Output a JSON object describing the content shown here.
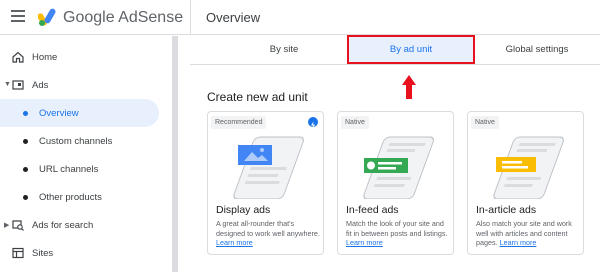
{
  "header": {
    "brand": "Google AdSense",
    "page_title": "Overview",
    "logo_colors": [
      "#fbbc04",
      "#4285f4",
      "#34a853"
    ]
  },
  "sidebar": {
    "items": [
      {
        "label": "Home",
        "icon": "home-icon"
      },
      {
        "label": "Ads",
        "icon": "ads-icon",
        "expanded": true
      },
      {
        "label": "Overview",
        "active": true
      },
      {
        "label": "Custom channels"
      },
      {
        "label": "URL channels"
      },
      {
        "label": "Other products"
      },
      {
        "label": "Ads for search",
        "icon": "search-ads-icon"
      },
      {
        "label": "Sites",
        "icon": "sites-icon"
      }
    ]
  },
  "tabs": [
    {
      "label": "By site"
    },
    {
      "label": "By ad unit",
      "selected": true
    },
    {
      "label": "Global settings"
    }
  ],
  "section_title": "Create new ad unit",
  "cards": [
    {
      "badge": "Recommended",
      "title": "Display ads",
      "description": "A great all-rounder that's designed to work well anywhere.",
      "link": "Learn more",
      "accent": "#4285f4"
    },
    {
      "badge": "Native",
      "title": "In-feed ads",
      "description": "Match the look of your site and fit in between posts and listings.",
      "link": "Learn more",
      "accent": "#34a853"
    },
    {
      "badge": "Native",
      "title": "In-article ads",
      "description": "Also match your site and work well with articles and content pages.",
      "link": "Learn more",
      "accent": "#fbbc04"
    }
  ],
  "colors": {
    "accent_blue": "#1a73e8",
    "highlight_red": "#e8101c"
  }
}
